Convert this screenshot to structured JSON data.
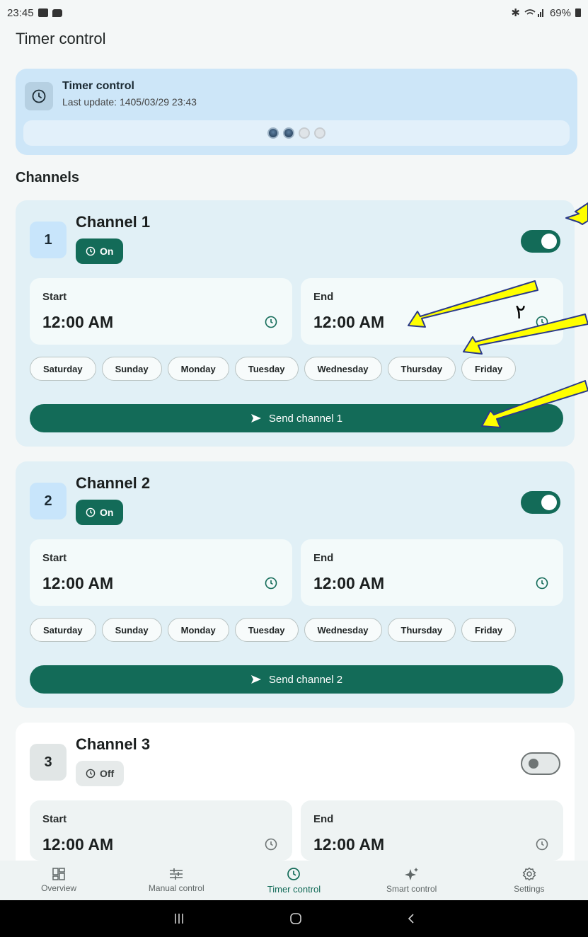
{
  "status_bar": {
    "time": "23:45",
    "battery": "69%"
  },
  "app": {
    "title": "Timer control"
  },
  "hero": {
    "icon": "clock-icon",
    "title": "Timer control",
    "subtitle": "Last update: 1405/03/29 23:43",
    "pager": {
      "count": 4,
      "active_indices": [
        0,
        1
      ]
    }
  },
  "channels_title": "Channels",
  "channels": [
    {
      "number": "1",
      "name": "Channel 1",
      "status": "On",
      "enabled": true,
      "start_label": "Start",
      "start_value": "12:00 AM",
      "end_label": "End",
      "end_value": "12:00 AM",
      "days": [
        "Saturday",
        "Sunday",
        "Monday",
        "Tuesday",
        "Wednesday",
        "Thursday",
        "Friday"
      ],
      "send_label": "Send channel 1"
    },
    {
      "number": "2",
      "name": "Channel 2",
      "status": "On",
      "enabled": true,
      "start_label": "Start",
      "start_value": "12:00 AM",
      "end_label": "End",
      "end_value": "12:00 AM",
      "days": [
        "Saturday",
        "Sunday",
        "Monday",
        "Tuesday",
        "Wednesday",
        "Thursday",
        "Friday"
      ],
      "send_label": "Send channel 2"
    },
    {
      "number": "3",
      "name": "Channel 3",
      "status": "Off",
      "enabled": false,
      "start_label": "Start",
      "start_value": "12:00 AM",
      "end_label": "End",
      "end_value": "12:00 AM"
    }
  ],
  "annotation": {
    "digit": "٢",
    "color": "#ffff00"
  },
  "bottom_nav": [
    {
      "label": "Overview",
      "icon": "dashboard-icon",
      "active": false
    },
    {
      "label": "Manual control",
      "icon": "sliders-icon",
      "active": false
    },
    {
      "label": "Timer control",
      "icon": "clock-icon",
      "active": true
    },
    {
      "label": "Smart control",
      "icon": "sparkle-icon",
      "active": false
    },
    {
      "label": "Settings",
      "icon": "gear-icon",
      "active": false
    }
  ],
  "colors": {
    "primary": "#136b58",
    "card_on": "#e1f0f6",
    "hero": "#cde6f8"
  }
}
